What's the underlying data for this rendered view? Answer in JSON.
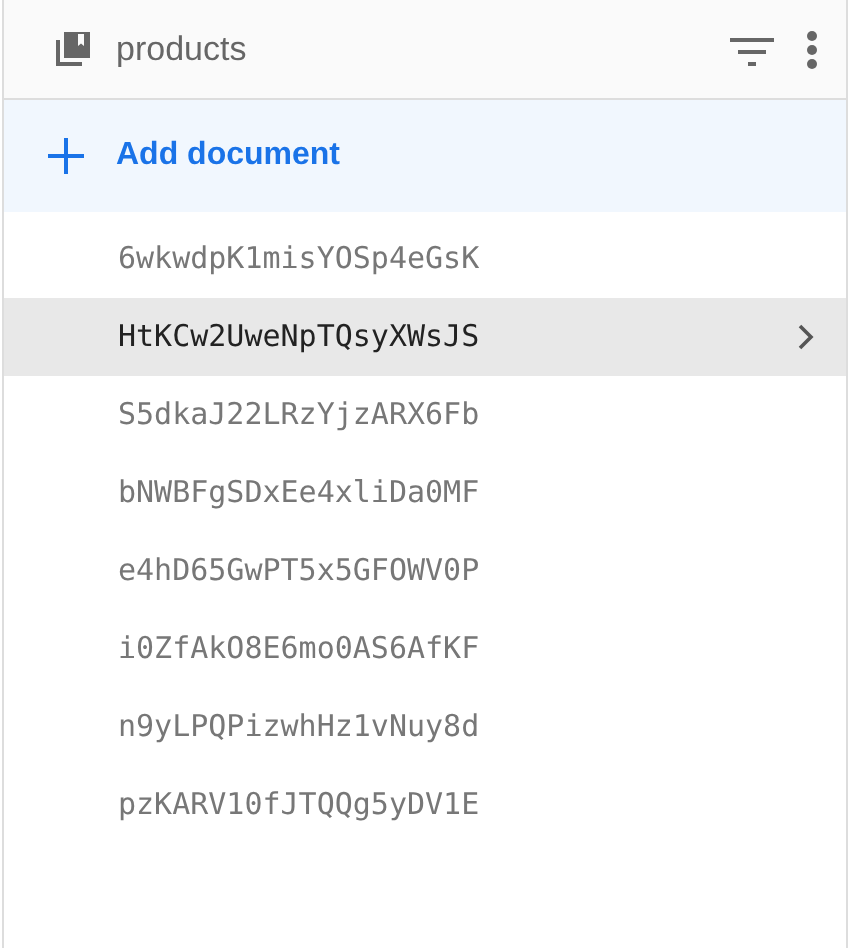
{
  "collection": {
    "title": "products"
  },
  "add_button": {
    "label": "Add document"
  },
  "documents": [
    {
      "id": "6wkwdpK1misYOSp4eGsK",
      "selected": false
    },
    {
      "id": "HtKCw2UweNpTQsyXWsJS",
      "selected": true
    },
    {
      "id": "S5dkaJ22LRzYjzARX6Fb",
      "selected": false
    },
    {
      "id": "bNWBFgSDxEe4xliDa0MF",
      "selected": false
    },
    {
      "id": "e4hD65GwPT5x5GFOWV0P",
      "selected": false
    },
    {
      "id": "i0ZfAkO8E6mo0AS6AfKF",
      "selected": false
    },
    {
      "id": "n9yLPQPizwhHz1vNuy8d",
      "selected": false
    },
    {
      "id": "pzKARV10fJTQQg5yDV1E",
      "selected": false
    }
  ]
}
